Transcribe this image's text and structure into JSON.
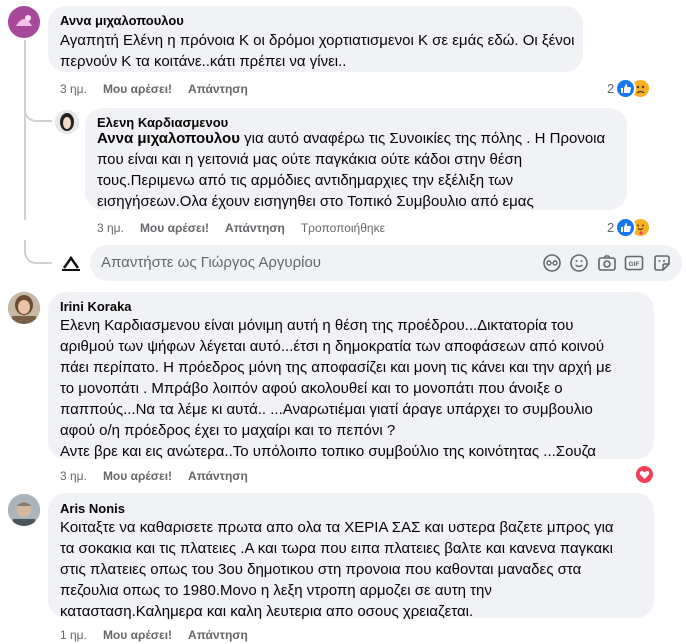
{
  "comments": [
    {
      "author": "Αννα μιχαλοπουλου",
      "lines": [
        "Αγαπητή Ελένη η πρόνοια Κ οι δρόμοι χορτιατισμενοι Κ σε εμάς εδώ. Οι ξένοι",
        "περνούν Κ τα κοιτάνε..κάτι πρέπει να γίνει.."
      ],
      "time": "3 ημ.",
      "like": "Μου αρέσει!",
      "reply": "Απάντηση",
      "reactions_count": "2",
      "reactions": [
        "like",
        "sad"
      ]
    },
    {
      "author": "Ελενη Καρδιασμενου",
      "mention": "Αννα μιχαλοπουλου",
      "lines": [
        " για αυτό αναφέρω τις Συνοικίες της πόλης . Η Προνοια",
        "που είναι και η γειτονιά μας ούτε παγκάκια ούτε κάδοι στην θέση",
        "τους.Περιμενω από τις αρμόδιες αντιδημαρχιες την εξέλιξη των",
        "εισηγήσεων.Ολα έχουν εισηγηθει στο Τοπικό Συμβουλιο από εμας"
      ],
      "time": "3 ημ.",
      "like": "Μου αρέσει!",
      "reply": "Απάντηση",
      "edited": "Τροποποιήθηκε",
      "reactions_count": "2",
      "reactions": [
        "like",
        "care"
      ]
    },
    {
      "author": "Irini Koraka",
      "lines": [
        "Ελενη Καρδιασμενου είναι μόνιμη αυτή η θέση της προέδρου...Δικτατορία του",
        "αριθμού των ψήφων λέγεται αυτό...έτσι η δημοκρατία των αποφάσεων από κοινού",
        "πάει περίπατο. Η πρόεδρος μόνη της αποφασίζει και μονη τις κάνει και την αρχή με",
        "το μονοπάτι . Μπράβο λοιπόν αφού ακολουθεί και το μονοπάτι που άνοιξε ο",
        "παππούς...Να τα λέμε κι αυτά.. ...Αναρωτιέμαι γιατί άραγε υπάρχει το συμβουλιο",
        "αφού ο/η πρόεδρος έχει το μαχαίρι και το πεπόνι ?",
        "Αντε βρε και εις ανώτερα..Το υπόλοιπο τοπικο συμβούλιο της κοινότητας ...Σουζα"
      ],
      "time": "3 ημ.",
      "like": "Μου αρέσει!",
      "reply": "Απάντηση",
      "reactions": [
        "love"
      ]
    },
    {
      "author": "Aris Nonis",
      "lines": [
        "Κοιταξτε να καθαρισετε πρωτα απο ολα τα ΧΕΡΙΑ ΣΑΣ και υστερα βαζετε μπρος για",
        "τα σοκακια και τις πλατειες .Α και τωρα που ειπα πλατειες βαλτε και κανενα παγκακι",
        "στις πλατειες οπως του 3ου δημοτικου στη προνοια που καθονται μαναδες στα",
        "πεζουλια οπως το 1980.Μονο η λεξη ντροπη αρμοζει σε αυτη την",
        "κατασταση.Καλημερα και καλη λευτερια απο οσους χρειαζεται."
      ],
      "time": "1 ημ.",
      "like": "Μου αρέσει!",
      "reply": "Απάντηση"
    }
  ],
  "reply_box": {
    "placeholder": "Απαντήστε ως Γιώργος Αργυρίου"
  },
  "colors": {
    "bubble": "#f0f2f5",
    "like": "#1877f2",
    "love": "#f33e58",
    "meta": "#65676b"
  }
}
